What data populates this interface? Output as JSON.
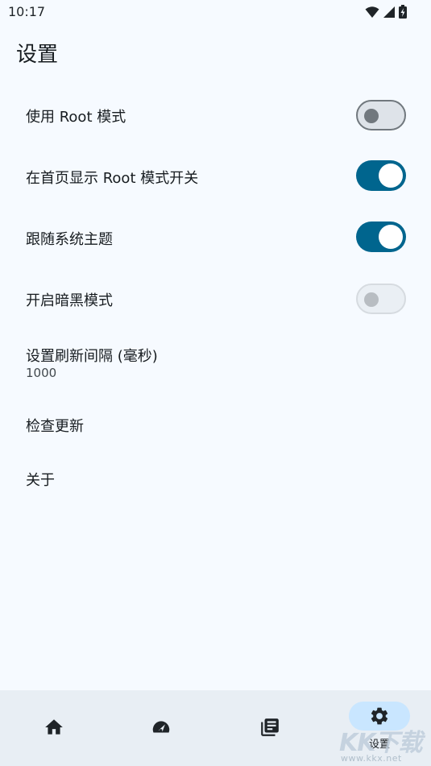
{
  "status_bar": {
    "time": "10:17",
    "icons": [
      "wifi-icon",
      "cell-signal-icon",
      "battery-charging-icon"
    ]
  },
  "page": {
    "title": "设置"
  },
  "settings": [
    {
      "label": "使用 Root 模式",
      "type": "switch",
      "checked": false,
      "enabled": true
    },
    {
      "label": "在首页显示 Root 模式开关",
      "type": "switch",
      "checked": true,
      "enabled": true
    },
    {
      "label": "跟随系统主题",
      "type": "switch",
      "checked": true,
      "enabled": true
    },
    {
      "label": "开启暗黑模式",
      "type": "switch",
      "checked": false,
      "enabled": false
    },
    {
      "label": "设置刷新间隔 (毫秒)",
      "type": "value",
      "value": "1000"
    },
    {
      "label": "检查更新",
      "type": "action"
    },
    {
      "label": "关于",
      "type": "action"
    }
  ],
  "bottom_nav": {
    "items": [
      {
        "icon": "home-icon",
        "label": "",
        "active": false
      },
      {
        "icon": "speedometer-icon",
        "label": "",
        "active": false
      },
      {
        "icon": "library-books-icon",
        "label": "",
        "active": false
      },
      {
        "icon": "gear-icon",
        "label": "设置",
        "active": true
      }
    ]
  },
  "watermark": {
    "text": "KK下载",
    "url": "www.kkx.net"
  },
  "colors": {
    "background": "#f6faff",
    "accent": "#00658e",
    "nav_background": "#e8eef4",
    "nav_active_pill": "#c9e6ff"
  }
}
